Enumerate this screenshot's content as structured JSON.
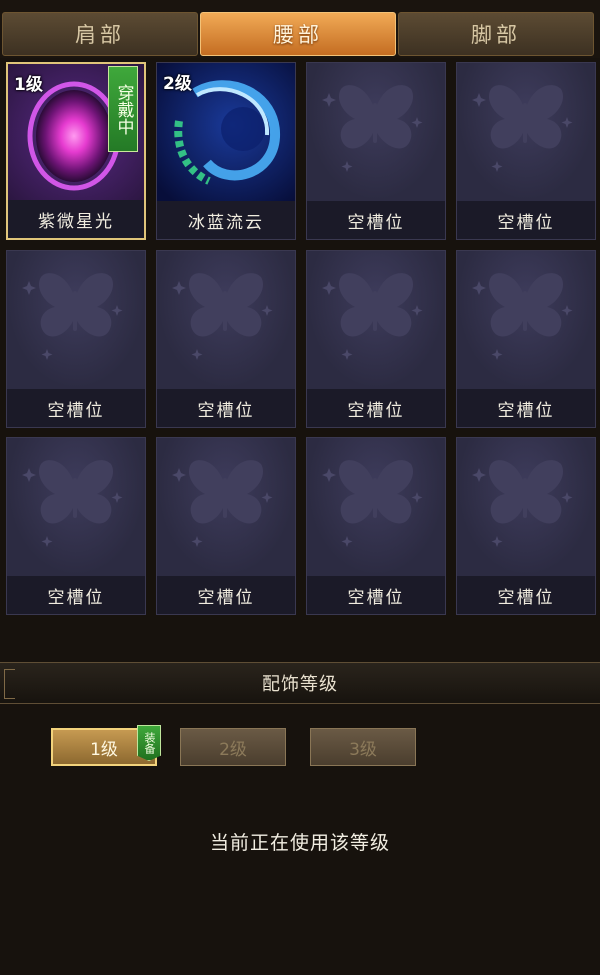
{
  "tabs": [
    {
      "label": "肩部",
      "active": false
    },
    {
      "label": "腰部",
      "active": true
    },
    {
      "label": "脚部",
      "active": false
    }
  ],
  "slots": [
    {
      "name": "紫微星光",
      "level": "1级",
      "worn_tag": "穿戴中",
      "type": "purple-orb"
    },
    {
      "name": "冰蓝流云",
      "level": "2级",
      "type": "blue-swirl"
    },
    {
      "name": "空槽位",
      "type": "empty"
    },
    {
      "name": "空槽位",
      "type": "empty"
    },
    {
      "name": "空槽位",
      "type": "empty"
    },
    {
      "name": "空槽位",
      "type": "empty"
    },
    {
      "name": "空槽位",
      "type": "empty"
    },
    {
      "name": "空槽位",
      "type": "empty"
    },
    {
      "name": "空槽位",
      "type": "empty"
    },
    {
      "name": "空槽位",
      "type": "empty"
    },
    {
      "name": "空槽位",
      "type": "empty"
    },
    {
      "name": "空槽位",
      "type": "empty"
    }
  ],
  "section": {
    "title": "配饰等级"
  },
  "levels": [
    {
      "label": "1级",
      "active": true,
      "badge": "装备"
    },
    {
      "label": "2级",
      "active": false
    },
    {
      "label": "3级",
      "active": false
    }
  ],
  "status": "当前正在使用该等级",
  "colors": {
    "accent": "#e0c57a",
    "equipped_green": "#3fa83b",
    "slot_bg": "#2c2b41"
  }
}
